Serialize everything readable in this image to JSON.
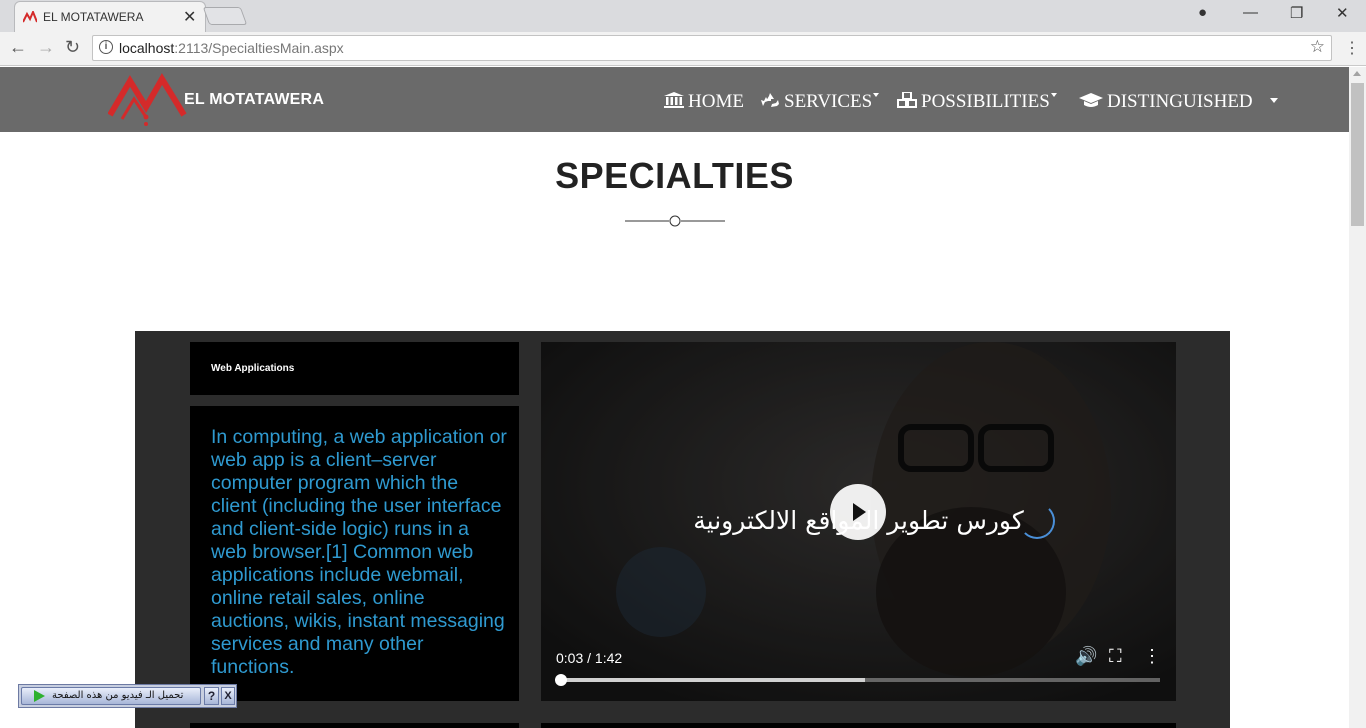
{
  "browser": {
    "tab": {
      "title": "EL MOTATAWERA",
      "close": "✕",
      "favicon": "motatawera-logo-icon"
    },
    "window_controls": {
      "account": "●",
      "minimize": "—",
      "restore": "❐",
      "close": "✕"
    },
    "nav": {
      "back": "←",
      "forward": "→",
      "reload": "↻"
    },
    "address": {
      "host": "localhost",
      "rest": ":2113/SpecialtiesMain.aspx",
      "info": "i",
      "star": "☆"
    },
    "menu": "⋮"
  },
  "site": {
    "brand": "EL MOTATAWERA",
    "brand_color": "#d42a2a",
    "nav_bg": "#6a6a6a",
    "nav": [
      {
        "label": "HOME",
        "icon": "bank-icon",
        "dropdown": false
      },
      {
        "label": "SERVICES",
        "icon": "recycle-icon",
        "dropdown": true
      },
      {
        "label": "POSSIBILITIES",
        "icon": "cubes-icon",
        "dropdown": true
      },
      {
        "label": "DISTINGUISHED",
        "icon": "graduation-cap-icon",
        "dropdown": false
      }
    ]
  },
  "main": {
    "title": "SPECIALTIES",
    "card": {
      "heading": "Web Applications",
      "body": "In computing, a web application or web app is a client–server computer program which the client (including the user interface and client-side logic) runs in a web browser.[1] Common web applications include webmail, online retail sales, online auctions, wikis, instant messaging services and many other functions.",
      "text_color": "#2f9ad0"
    },
    "video": {
      "caption": "كورس تطوير المواقع الالكترونية",
      "time": "0:03 / 1:42",
      "played_fraction": 0.0066,
      "buffered_fraction": 0.51,
      "controls": {
        "volume": "🔊",
        "fullscreen": "⛶",
        "more": "⋮"
      }
    }
  },
  "download_bar": {
    "label": "تحميل الـ فيديو من هذه الصفحة",
    "help": "?",
    "close": "X"
  }
}
